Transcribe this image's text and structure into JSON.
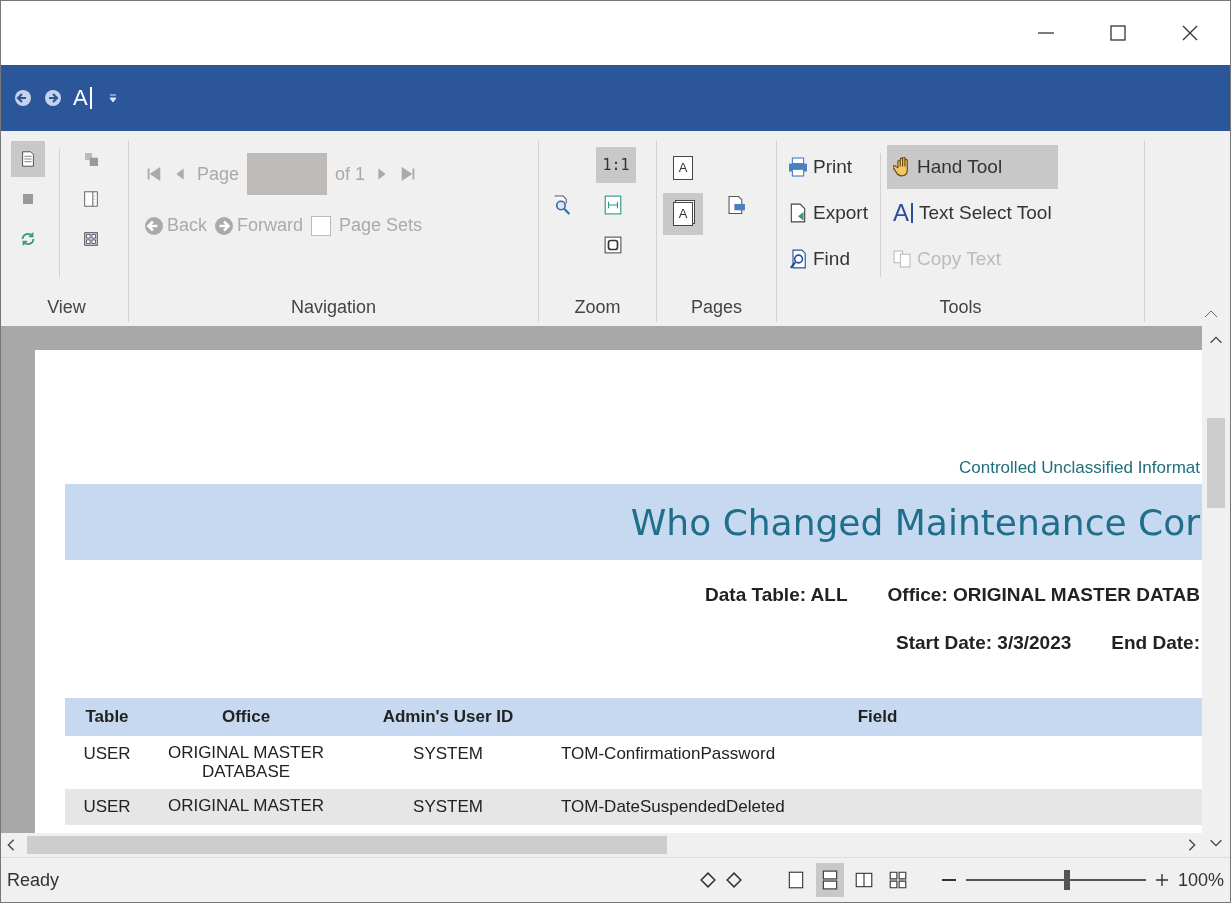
{
  "window": {
    "controls": [
      {
        "kind": "minimize"
      },
      {
        "kind": "maximize"
      },
      {
        "kind": "close"
      }
    ]
  },
  "quick_access": [
    {
      "kind": "back"
    },
    {
      "kind": "forward"
    },
    {
      "kind": "text-select",
      "glyph": "A"
    },
    {
      "kind": "customize"
    }
  ],
  "ribbon": {
    "view": {
      "label": "View",
      "buttons": [
        {
          "kind": "page",
          "selected": true
        },
        {
          "kind": "stop",
          "selected": false
        },
        {
          "kind": "refresh",
          "selected": false
        },
        {
          "kind": "copy",
          "selected": false
        },
        {
          "kind": "sidebar",
          "selected": false
        },
        {
          "kind": "thumbnails",
          "selected": false
        }
      ]
    },
    "navigation": {
      "label": "Navigation",
      "page_label": "Page",
      "page_count": "of 1",
      "back": "Back",
      "forward": "Forward",
      "page_sets": {
        "label": "Page Sets",
        "checked": false
      }
    },
    "zoom": {
      "label": "Zoom",
      "actual_size": {
        "label": "1:1",
        "selected": true
      },
      "buttons": [
        {
          "kind": "zoom",
          "selected": false
        },
        {
          "kind": "fit-width",
          "selected": false
        },
        {
          "kind": "fit-page",
          "selected": false
        }
      ]
    },
    "pages": {
      "label": "Pages",
      "buttons": [
        {
          "kind": "single",
          "glyph": "A",
          "selected": false
        },
        {
          "kind": "double",
          "glyph": "A",
          "selected": true
        },
        {
          "kind": "layout",
          "selected": false
        }
      ]
    },
    "tools": {
      "label": "Tools",
      "items": [
        {
          "kind": "print",
          "label": "Print",
          "selected": false,
          "disabled": false
        },
        {
          "kind": "export",
          "label": "Export",
          "selected": false,
          "disabled": false
        },
        {
          "kind": "find",
          "label": "Find",
          "selected": false,
          "disabled": false
        },
        {
          "kind": "hand",
          "label": "Hand Tool",
          "selected": true,
          "disabled": false
        },
        {
          "kind": "text-select",
          "glyph": "A",
          "label": "Text Select Tool",
          "selected": false,
          "disabled": false
        },
        {
          "kind": "copy",
          "label": "Copy Text",
          "selected": false,
          "disabled": true
        }
      ]
    }
  },
  "report": {
    "classification": "Controlled Unclassified Informat",
    "title": "Who Changed Maintenance Cor",
    "data_table": "Data Table: ALL",
    "office": "Office: ORIGINAL MASTER DATAB",
    "start_date": "Start Date: 3/3/2023",
    "end_date": "End Date:",
    "table": {
      "columns": [
        "Table",
        "Office",
        "Admin's User ID",
        "Field"
      ],
      "rows": [
        {
          "shaded": false,
          "cells": [
            "USER",
            "ORIGINAL MASTER DATABASE",
            "SYSTEM",
            "TOM-ConfirmationPassword"
          ]
        },
        {
          "shaded": true,
          "cells": [
            "USER",
            "ORIGINAL MASTER",
            "SYSTEM",
            "TOM-DateSuspendedDeleted"
          ]
        }
      ]
    }
  },
  "status_bar": {
    "text": "Ready",
    "view_modes": [
      {
        "selected": false
      },
      {
        "selected": true
      },
      {
        "selected": false
      },
      {
        "selected": false
      }
    ],
    "zoom": {
      "level": 0.56,
      "reading": "100%"
    }
  }
}
